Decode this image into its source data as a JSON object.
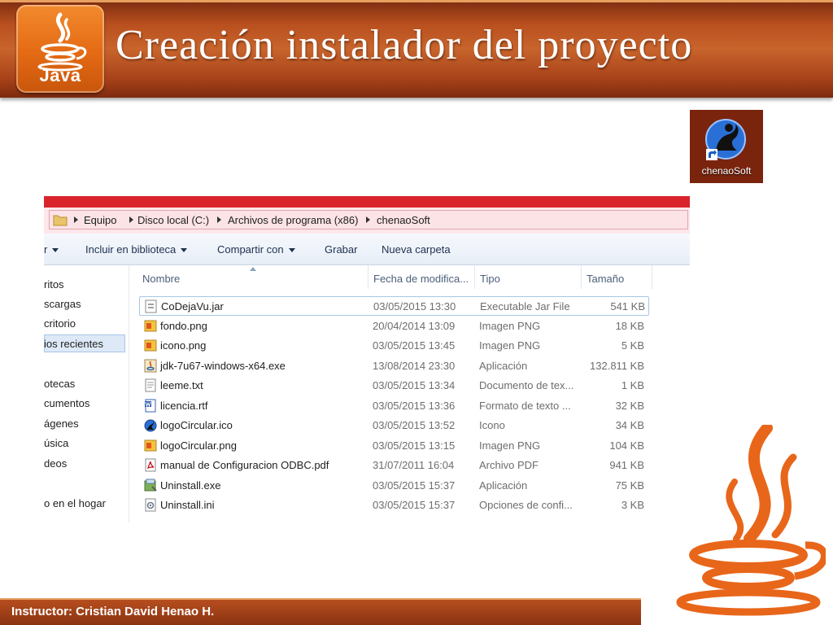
{
  "slide": {
    "title": "Creación instalador del proyecto",
    "logo_text": "Java",
    "footer": "Instructor: Cristian David Henao H."
  },
  "desktop_shortcut": {
    "label": "chenaoSoft",
    "icon": "chenaosoft-app-icon"
  },
  "explorer": {
    "breadcrumb": [
      "Equipo",
      "Disco local (C:)",
      "Archivos de programa (x86)",
      "chenaoSoft"
    ],
    "toolbar": {
      "organize_truncated": "r",
      "include_library": "Incluir en biblioteca",
      "share_with": "Compartir con",
      "burn": "Grabar",
      "new_folder": "Nueva carpeta"
    },
    "nav_items": [
      "ritos",
      "scargas",
      "critorio",
      "ios recientes",
      "otecas",
      "cumentos",
      "ágenes",
      "úsica",
      "deos",
      "o en el hogar"
    ],
    "nav_selected_index": 3,
    "columns": {
      "name": "Nombre",
      "date": "Fecha de modifica...",
      "type": "Tipo",
      "size": "Tamaño"
    },
    "files": [
      {
        "name": "CoDejaVu.jar",
        "date": "03/05/2015 13:30",
        "type": "Executable Jar File",
        "size": "541 KB",
        "icon": "jar-file-icon"
      },
      {
        "name": "fondo.png",
        "date": "20/04/2014 13:09",
        "type": "Imagen PNG",
        "size": "18 KB",
        "icon": "png-image-icon"
      },
      {
        "name": "icono.png",
        "date": "03/05/2015 13:45",
        "type": "Imagen PNG",
        "size": "5 KB",
        "icon": "png-image-icon"
      },
      {
        "name": "jdk-7u67-windows-x64.exe",
        "date": "13/08/2014 23:30",
        "type": "Aplicación",
        "size": "132.811 KB",
        "icon": "java-installer-icon"
      },
      {
        "name": "leeme.txt",
        "date": "03/05/2015 13:34",
        "type": "Documento de tex...",
        "size": "1 KB",
        "icon": "text-file-icon"
      },
      {
        "name": "licencia.rtf",
        "date": "03/05/2015 13:36",
        "type": "Formato de texto ...",
        "size": "32 KB",
        "icon": "rtf-document-icon"
      },
      {
        "name": "logoCircular.ico",
        "date": "03/05/2015 13:52",
        "type": "Icono",
        "size": "34 KB",
        "icon": "circular-logo-icon"
      },
      {
        "name": "logoCircular.png",
        "date": "03/05/2015 13:15",
        "type": "Imagen PNG",
        "size": "104 KB",
        "icon": "png-image-icon"
      },
      {
        "name": "manual de Configuracion ODBC.pdf",
        "date": "31/07/2011 16:04",
        "type": "Archivo PDF",
        "size": "941 KB",
        "icon": "pdf-file-icon"
      },
      {
        "name": "Uninstall.exe",
        "date": "03/05/2015 15:37",
        "type": "Aplicación",
        "size": "75 KB",
        "icon": "uninstall-exe-icon"
      },
      {
        "name": "Uninstall.ini",
        "date": "03/05/2015 15:37",
        "type": "Opciones de confi...",
        "size": "3 KB",
        "icon": "ini-settings-icon"
      }
    ]
  },
  "colors": {
    "header_orange": "#c8642c",
    "java_orange": "#e46a14",
    "address_bar_tint": "#fde7ea",
    "title_strip_red": "#d9242c"
  }
}
